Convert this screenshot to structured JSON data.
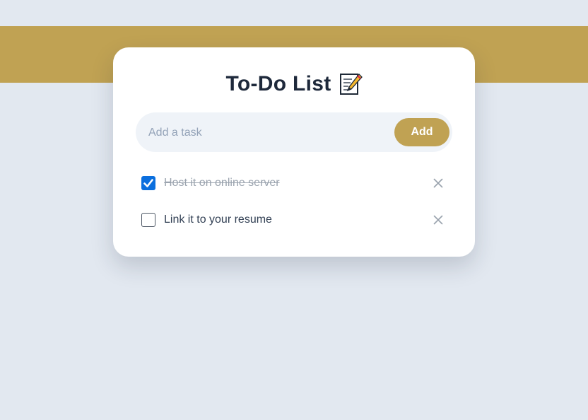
{
  "colors": {
    "accent": "#c0a253",
    "background": "#e2e8f0",
    "card": "#ffffff",
    "checkbox_checked": "#0b6fde"
  },
  "header": {
    "title": "To-Do List",
    "title_icon": "memo-icon"
  },
  "task_input": {
    "placeholder": "Add a task",
    "value": ""
  },
  "add_button": {
    "label": "Add"
  },
  "tasks": [
    {
      "text": "Host it on online server",
      "completed": true,
      "delete_icon": "close-icon"
    },
    {
      "text": "Link it to your resume",
      "completed": false,
      "delete_icon": "close-icon"
    }
  ]
}
